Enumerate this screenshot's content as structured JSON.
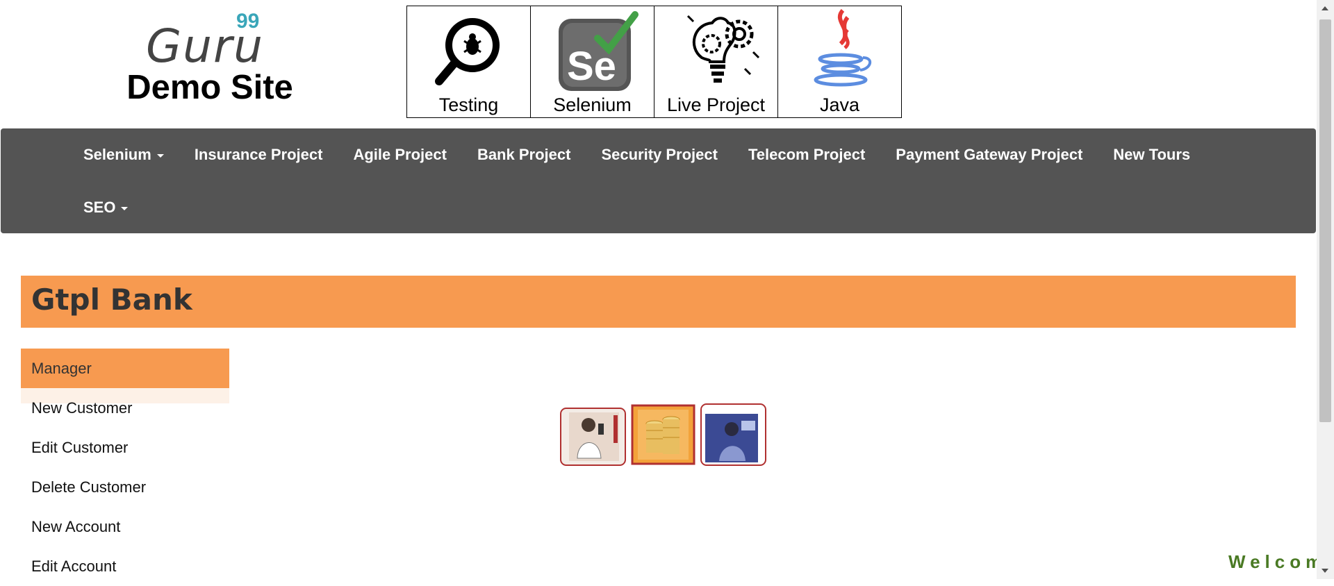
{
  "logo": {
    "guru": "Guru",
    "sup": "99",
    "demo": "Demo Site"
  },
  "tiles": [
    {
      "label": "Testing",
      "icon": "magnifier-bug-icon"
    },
    {
      "label": "Selenium",
      "icon": "selenium-logo-icon"
    },
    {
      "label": "Live Project",
      "icon": "lightbulb-gears-icon"
    },
    {
      "label": "Java",
      "icon": "java-logo-icon"
    }
  ],
  "nav": {
    "row1": [
      "Selenium",
      "Insurance Project",
      "Agile Project",
      "Bank Project",
      "Security Project",
      "Telecom Project",
      "Payment Gateway Project",
      "New Tours"
    ],
    "row2": [
      "SEO"
    ]
  },
  "bank": {
    "title": "Gtpl Bank"
  },
  "sidebar": {
    "header": "Manager",
    "items": [
      "New Customer",
      "Edit Customer",
      "Delete Customer",
      "New Account",
      "Edit Account"
    ]
  },
  "welcome": "Welcom",
  "colors": {
    "nav_bg": "#545454",
    "accent": "#f79a50",
    "welcome": "#4a7a24"
  }
}
